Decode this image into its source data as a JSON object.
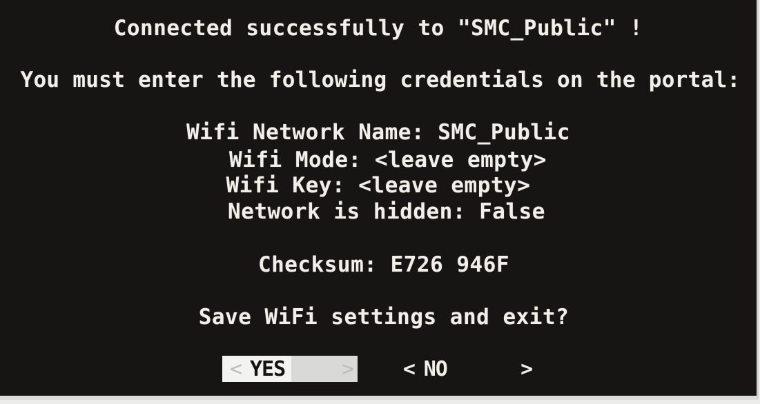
{
  "screen": {
    "title": "Connected successfully to \"SMC_Public\" !",
    "instruction": "You must enter the following credentials on the portal:",
    "credentials": [
      "Wifi Network Name: SMC_Public",
      "Wifi Mode: <leave empty>",
      "Wifi Key: <leave empty>",
      "Network is hidden: False"
    ],
    "checksum": "Checksum: E726 946F",
    "question": "Save WiFi settings and exit?"
  },
  "dialog": {
    "yes": {
      "left": "<",
      "label": "YES",
      "right": ">"
    },
    "no": {
      "left": "<",
      "label": "NO",
      "right": ">"
    }
  },
  "colors": {
    "background": "#171513",
    "text": "#f1efe8",
    "selected_button": "#f3f3f1",
    "selected_text": "#151311"
  }
}
